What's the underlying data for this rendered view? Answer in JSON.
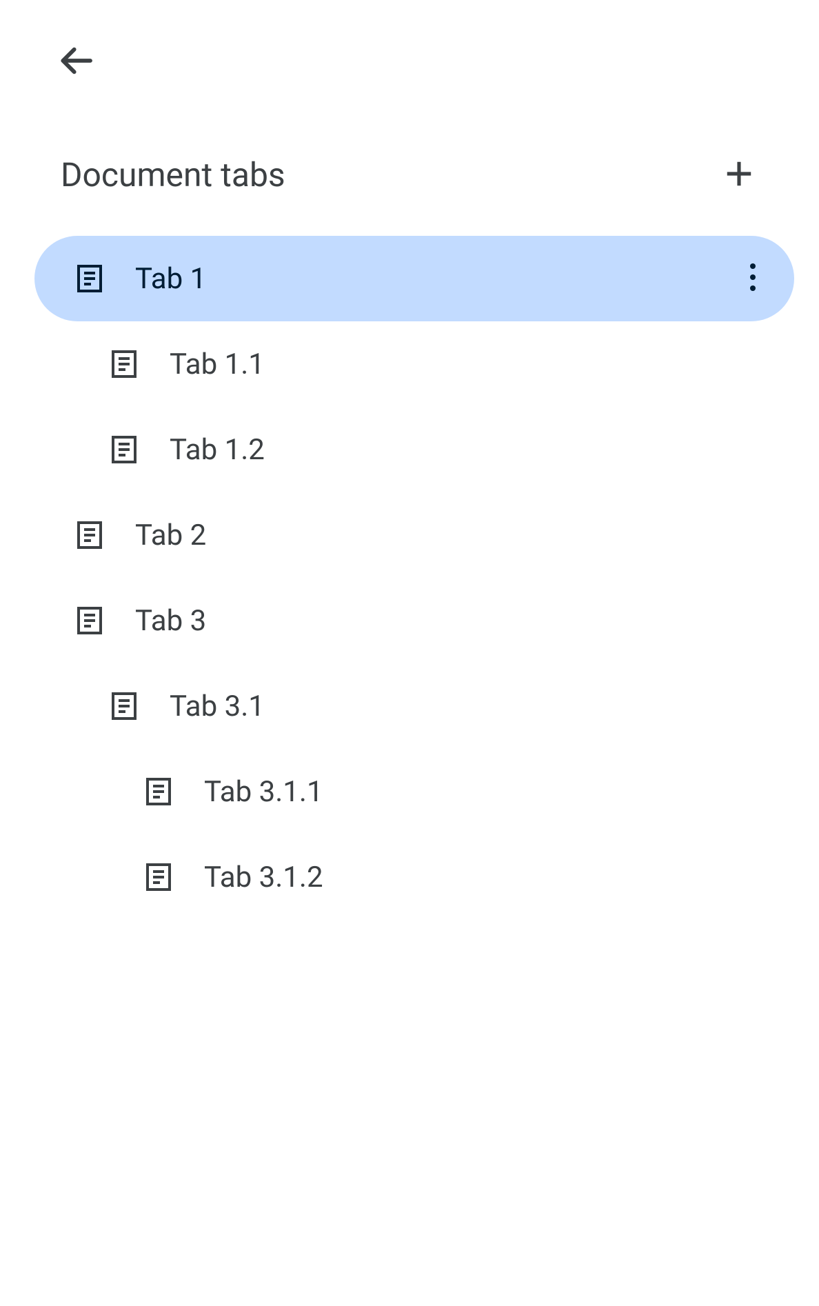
{
  "header": {
    "title": "Document tabs"
  },
  "tabs": [
    {
      "label": "Tab 1",
      "level": 0,
      "selected": true
    },
    {
      "label": "Tab 1.1",
      "level": 1,
      "selected": false
    },
    {
      "label": "Tab 1.2",
      "level": 1,
      "selected": false
    },
    {
      "label": "Tab 2",
      "level": 0,
      "selected": false
    },
    {
      "label": "Tab 3",
      "level": 0,
      "selected": false
    },
    {
      "label": "Tab 3.1",
      "level": 1,
      "selected": false
    },
    {
      "label": "Tab 3.1.1",
      "level": 2,
      "selected": false
    },
    {
      "label": "Tab 3.1.2",
      "level": 2,
      "selected": false
    }
  ],
  "colors": {
    "selected_bg": "#c2dbff",
    "selected_fg": "#001d35",
    "text": "#3c4043",
    "icon": "#3c4043"
  }
}
